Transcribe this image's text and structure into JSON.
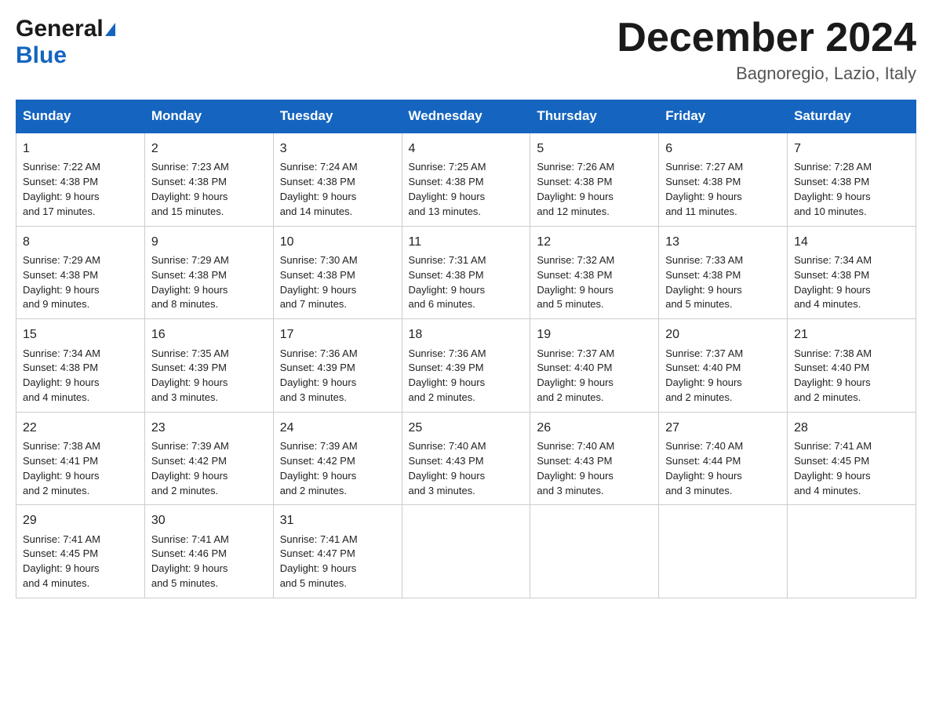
{
  "logo": {
    "text_general": "General",
    "text_blue": "Blue",
    "arrow_color": "#1565c0"
  },
  "header": {
    "month_title": "December 2024",
    "location": "Bagnoregio, Lazio, Italy"
  },
  "days_of_week": [
    "Sunday",
    "Monday",
    "Tuesday",
    "Wednesday",
    "Thursday",
    "Friday",
    "Saturday"
  ],
  "weeks": [
    [
      {
        "day": "1",
        "sunrise": "7:22 AM",
        "sunset": "4:38 PM",
        "daylight": "9 hours and 17 minutes."
      },
      {
        "day": "2",
        "sunrise": "7:23 AM",
        "sunset": "4:38 PM",
        "daylight": "9 hours and 15 minutes."
      },
      {
        "day": "3",
        "sunrise": "7:24 AM",
        "sunset": "4:38 PM",
        "daylight": "9 hours and 14 minutes."
      },
      {
        "day": "4",
        "sunrise": "7:25 AM",
        "sunset": "4:38 PM",
        "daylight": "9 hours and 13 minutes."
      },
      {
        "day": "5",
        "sunrise": "7:26 AM",
        "sunset": "4:38 PM",
        "daylight": "9 hours and 12 minutes."
      },
      {
        "day": "6",
        "sunrise": "7:27 AM",
        "sunset": "4:38 PM",
        "daylight": "9 hours and 11 minutes."
      },
      {
        "day": "7",
        "sunrise": "7:28 AM",
        "sunset": "4:38 PM",
        "daylight": "9 hours and 10 minutes."
      }
    ],
    [
      {
        "day": "8",
        "sunrise": "7:29 AM",
        "sunset": "4:38 PM",
        "daylight": "9 hours and 9 minutes."
      },
      {
        "day": "9",
        "sunrise": "7:29 AM",
        "sunset": "4:38 PM",
        "daylight": "9 hours and 8 minutes."
      },
      {
        "day": "10",
        "sunrise": "7:30 AM",
        "sunset": "4:38 PM",
        "daylight": "9 hours and 7 minutes."
      },
      {
        "day": "11",
        "sunrise": "7:31 AM",
        "sunset": "4:38 PM",
        "daylight": "9 hours and 6 minutes."
      },
      {
        "day": "12",
        "sunrise": "7:32 AM",
        "sunset": "4:38 PM",
        "daylight": "9 hours and 5 minutes."
      },
      {
        "day": "13",
        "sunrise": "7:33 AM",
        "sunset": "4:38 PM",
        "daylight": "9 hours and 5 minutes."
      },
      {
        "day": "14",
        "sunrise": "7:34 AM",
        "sunset": "4:38 PM",
        "daylight": "9 hours and 4 minutes."
      }
    ],
    [
      {
        "day": "15",
        "sunrise": "7:34 AM",
        "sunset": "4:38 PM",
        "daylight": "9 hours and 4 minutes."
      },
      {
        "day": "16",
        "sunrise": "7:35 AM",
        "sunset": "4:39 PM",
        "daylight": "9 hours and 3 minutes."
      },
      {
        "day": "17",
        "sunrise": "7:36 AM",
        "sunset": "4:39 PM",
        "daylight": "9 hours and 3 minutes."
      },
      {
        "day": "18",
        "sunrise": "7:36 AM",
        "sunset": "4:39 PM",
        "daylight": "9 hours and 2 minutes."
      },
      {
        "day": "19",
        "sunrise": "7:37 AM",
        "sunset": "4:40 PM",
        "daylight": "9 hours and 2 minutes."
      },
      {
        "day": "20",
        "sunrise": "7:37 AM",
        "sunset": "4:40 PM",
        "daylight": "9 hours and 2 minutes."
      },
      {
        "day": "21",
        "sunrise": "7:38 AM",
        "sunset": "4:40 PM",
        "daylight": "9 hours and 2 minutes."
      }
    ],
    [
      {
        "day": "22",
        "sunrise": "7:38 AM",
        "sunset": "4:41 PM",
        "daylight": "9 hours and 2 minutes."
      },
      {
        "day": "23",
        "sunrise": "7:39 AM",
        "sunset": "4:42 PM",
        "daylight": "9 hours and 2 minutes."
      },
      {
        "day": "24",
        "sunrise": "7:39 AM",
        "sunset": "4:42 PM",
        "daylight": "9 hours and 2 minutes."
      },
      {
        "day": "25",
        "sunrise": "7:40 AM",
        "sunset": "4:43 PM",
        "daylight": "9 hours and 3 minutes."
      },
      {
        "day": "26",
        "sunrise": "7:40 AM",
        "sunset": "4:43 PM",
        "daylight": "9 hours and 3 minutes."
      },
      {
        "day": "27",
        "sunrise": "7:40 AM",
        "sunset": "4:44 PM",
        "daylight": "9 hours and 3 minutes."
      },
      {
        "day": "28",
        "sunrise": "7:41 AM",
        "sunset": "4:45 PM",
        "daylight": "9 hours and 4 minutes."
      }
    ],
    [
      {
        "day": "29",
        "sunrise": "7:41 AM",
        "sunset": "4:45 PM",
        "daylight": "9 hours and 4 minutes."
      },
      {
        "day": "30",
        "sunrise": "7:41 AM",
        "sunset": "4:46 PM",
        "daylight": "9 hours and 5 minutes."
      },
      {
        "day": "31",
        "sunrise": "7:41 AM",
        "sunset": "4:47 PM",
        "daylight": "9 hours and 5 minutes."
      },
      null,
      null,
      null,
      null
    ]
  ],
  "labels": {
    "sunrise": "Sunrise:",
    "sunset": "Sunset:",
    "daylight": "Daylight:"
  }
}
